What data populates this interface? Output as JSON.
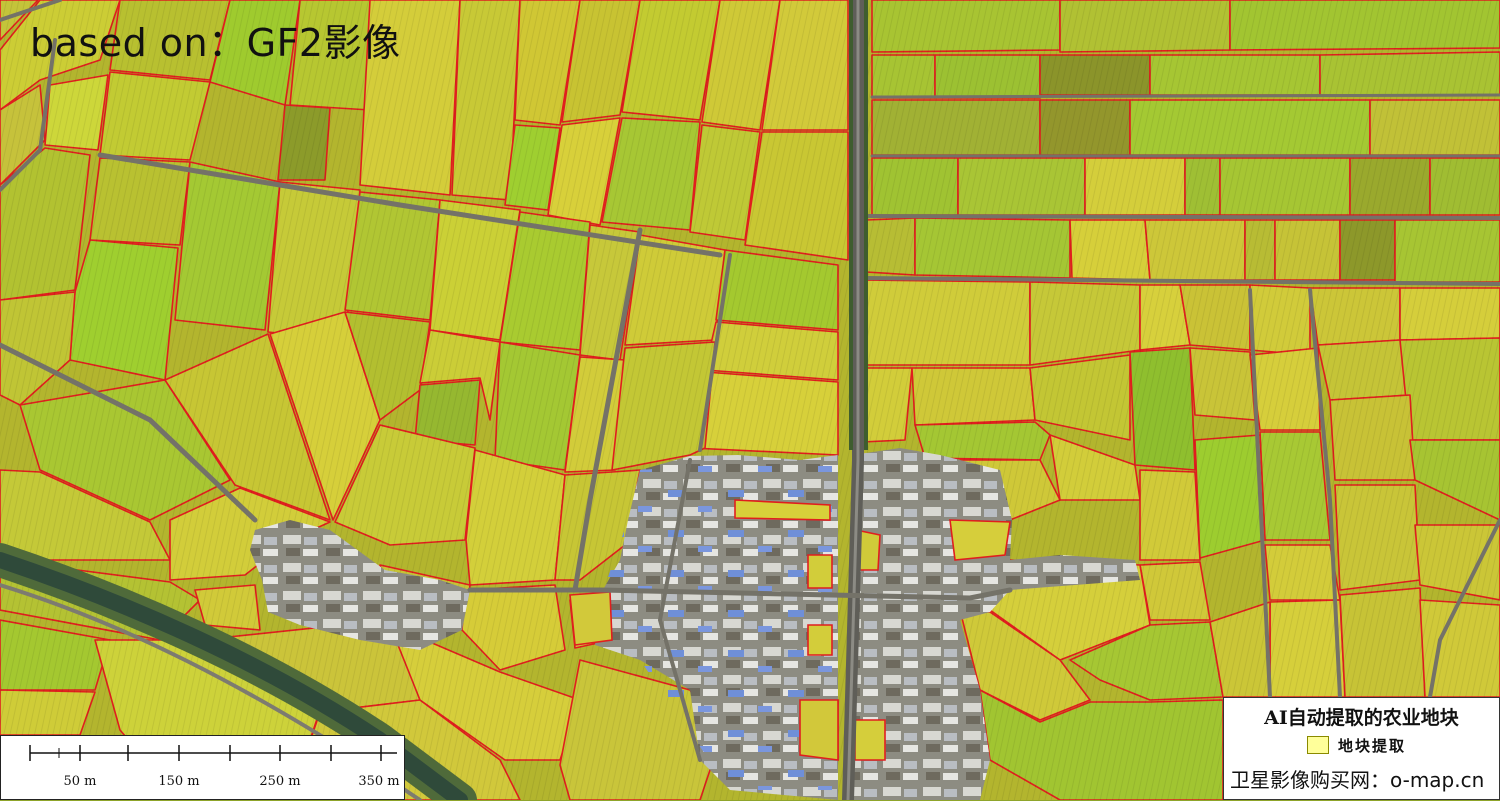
{
  "map": {
    "source_label": "based on：GF2影像",
    "colors": {
      "field_boundary": "#e01e1e",
      "road": "#6d6d6d",
      "canal": "#2f4a3a",
      "village": "#8a8b84",
      "field_yellow": "#d7d137",
      "field_green": "#9fcd2c",
      "field_olive": "#93952a"
    }
  },
  "scale_bar": {
    "labels": [
      "50 m",
      "150 m",
      "250 m",
      "350 m"
    ]
  },
  "legend": {
    "title": "AI自动提取的农业地块",
    "item_label": "地块提取",
    "item_icon": "yellow-square-swatch",
    "item_color": "#ffff9a",
    "credit": "卫星影像购买网：o-map.cn"
  }
}
